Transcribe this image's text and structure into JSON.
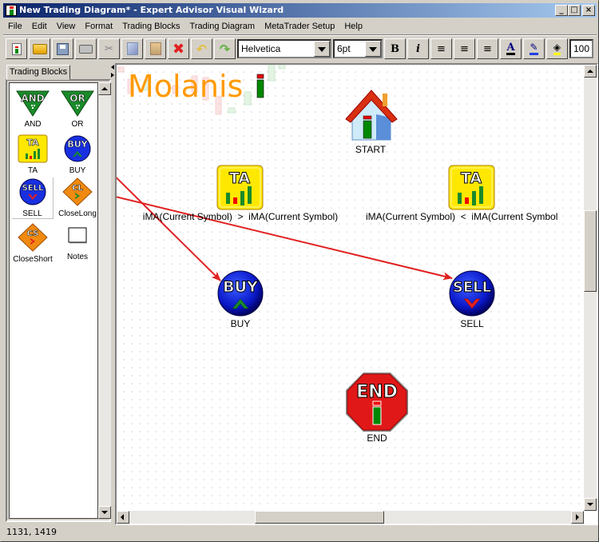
{
  "window": {
    "title": "New Trading Diagram* - Expert Advisor Visual Wizard",
    "minimize_label": "_",
    "maximize_label": "□",
    "close_label": "×"
  },
  "menu": [
    "File",
    "Edit",
    "View",
    "Format",
    "Trading Blocks",
    "Trading Diagram",
    "MetaTrader Setup",
    "Help"
  ],
  "toolbar": {
    "buttons": [
      "new-icon",
      "open-icon",
      "save-icon",
      "print-icon",
      "cut-icon",
      "copy-icon",
      "paste-icon",
      "delete-icon",
      "undo-icon",
      "redo-icon"
    ],
    "font_family": "Helvetica",
    "font_size": "6pt",
    "bold_label": "B",
    "italic_label": "i",
    "zoom_value": "100"
  },
  "palette": {
    "tab_label": "Trading Blocks",
    "items": [
      {
        "label": "AND",
        "type": "and"
      },
      {
        "label": "OR",
        "type": "or"
      },
      {
        "label": "TA",
        "type": "ta"
      },
      {
        "label": "BUY",
        "type": "buy"
      },
      {
        "label": "SELL",
        "type": "sell"
      },
      {
        "label": "CloseLong",
        "type": "closelong"
      },
      {
        "label": "CloseShort",
        "type": "closeshort"
      },
      {
        "label": "Notes",
        "type": "notes"
      }
    ],
    "icon_text": {
      "and": "AND",
      "or": "OR",
      "ta": "TA",
      "buy": "BUY",
      "sell": "SELL",
      "closelong": "CL",
      "closeshort": "CS"
    }
  },
  "canvas": {
    "logo": "Molanis",
    "nodes": {
      "start": {
        "label": "START"
      },
      "ta1": {
        "label": "iMA(Current Symbol)  >  iMA(Current Symbol)",
        "icon_text": "TA"
      },
      "ta2": {
        "label": "iMA(Current Symbol)  <  iMA(Current Symbol",
        "icon_text": "TA"
      },
      "buy": {
        "label": "BUY",
        "icon_text": "BUY"
      },
      "sell": {
        "label": "SELL",
        "icon_text": "SELL"
      },
      "end": {
        "label": "END",
        "icon_text": "END"
      }
    },
    "connections": [
      {
        "from": "ta1",
        "to": "buy"
      },
      {
        "from": "ta2",
        "to": "sell"
      }
    ],
    "connection_color": "#e02020"
  },
  "status": {
    "coords": "1131, 1419"
  }
}
